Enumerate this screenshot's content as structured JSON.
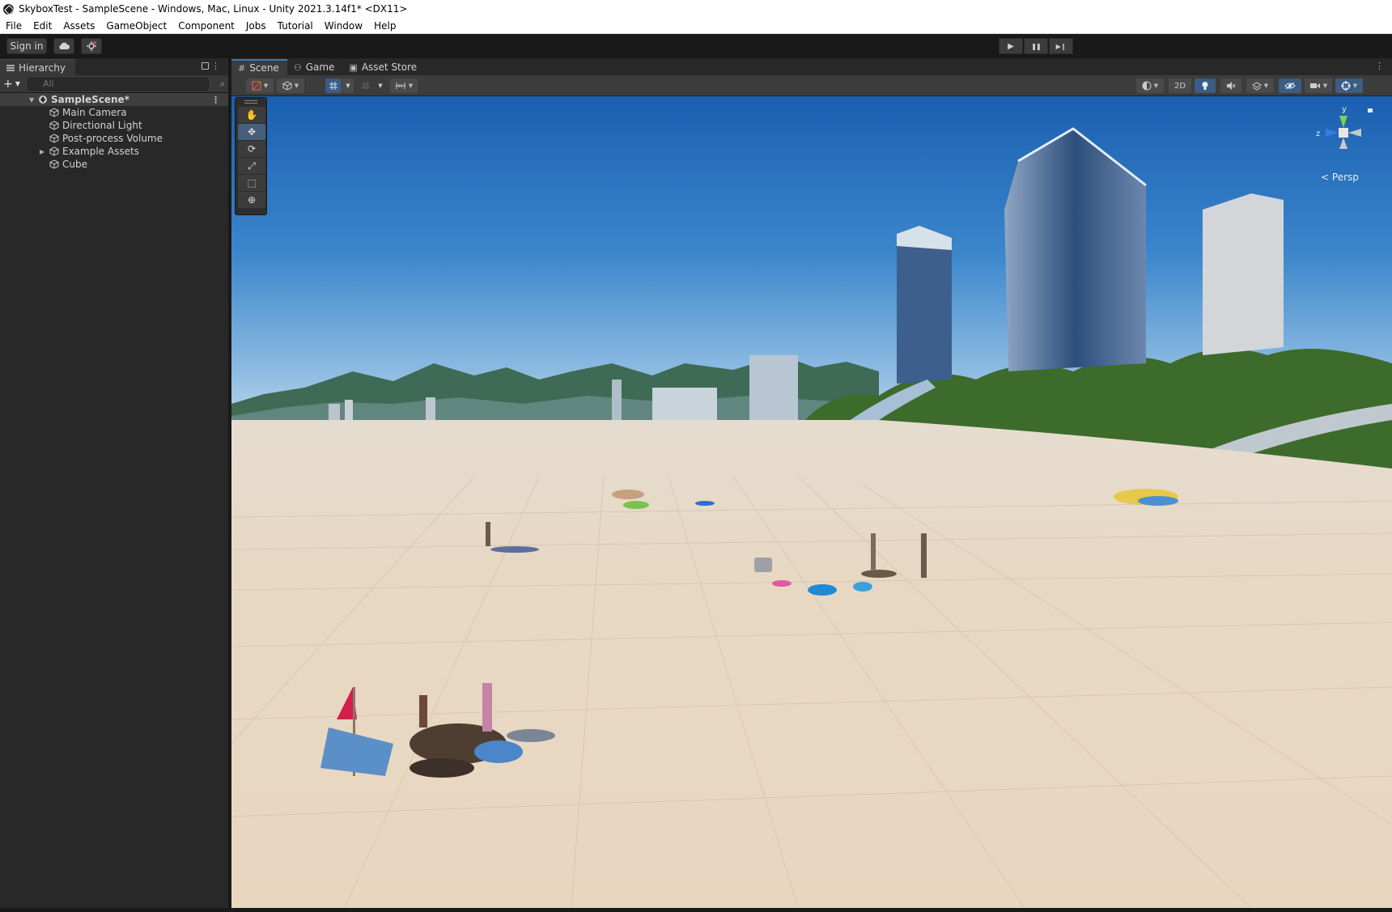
{
  "window": {
    "title": "SkyboxTest - SampleScene - Windows, Mac, Linux - Unity 2021.3.14f1* <DX11>"
  },
  "menu": {
    "items": [
      "File",
      "Edit",
      "Assets",
      "GameObject",
      "Component",
      "Jobs",
      "Tutorial",
      "Window",
      "Help"
    ]
  },
  "toolbar": {
    "sign_in_label": "Sign in",
    "cloud_icon": "cloud-icon",
    "collab_icon": "collab-icon",
    "play_icon": "▶",
    "pause_icon": "❚❚",
    "step_icon": "▶❙"
  },
  "hierarchy": {
    "tab_label": "Hierarchy",
    "add_label": "+",
    "search_placeholder": "All",
    "scene_name": "SampleScene*",
    "items": [
      {
        "label": "Main Camera",
        "has_children": false
      },
      {
        "label": "Directional Light",
        "has_children": false
      },
      {
        "label": "Post-process Volume",
        "has_children": false
      },
      {
        "label": "Example Assets",
        "has_children": true
      },
      {
        "label": "Cube",
        "has_children": false
      }
    ]
  },
  "scene_view": {
    "tabs": [
      {
        "label": "Scene",
        "icon": "#",
        "active": true
      },
      {
        "label": "Game",
        "icon": "⚇",
        "active": false
      },
      {
        "label": "Asset Store",
        "icon": "▣",
        "active": false
      }
    ],
    "toolbar_2d_label": "2D",
    "projection_label": "Persp",
    "gizmo_axes": {
      "y": "y",
      "z": "z"
    },
    "accent_color": "#3a79bb"
  },
  "tools": [
    "hand-tool",
    "move-tool",
    "rotate-tool",
    "scale-tool",
    "rect-tool",
    "transform-tool"
  ]
}
